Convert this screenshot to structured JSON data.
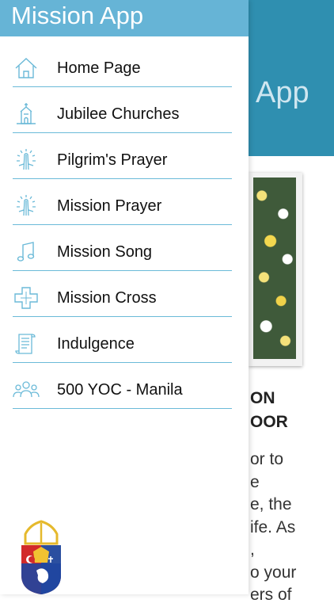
{
  "background": {
    "header_title": "App",
    "heading_lines": [
      "ON",
      "OOR"
    ],
    "text_lines": [
      "or to",
      "e",
      "e, the",
      "ife. As",
      ",",
      "o your",
      "ers of"
    ]
  },
  "drawer": {
    "title": "Mission App",
    "accent_color": "#66b4d6",
    "items": [
      {
        "label": "Home Page",
        "icon": "home-icon"
      },
      {
        "label": "Jubilee Churches",
        "icon": "church-icon"
      },
      {
        "label": "Pilgrim's Prayer",
        "icon": "praying-hands-icon"
      },
      {
        "label": "Mission Prayer",
        "icon": "praying-hands-icon"
      },
      {
        "label": "Mission Song",
        "icon": "music-note-icon"
      },
      {
        "label": "Mission Cross",
        "icon": "cross-icon"
      },
      {
        "label": "Indulgence",
        "icon": "scroll-icon"
      },
      {
        "label": "500 YOC - Manila",
        "icon": "people-icon"
      }
    ]
  }
}
